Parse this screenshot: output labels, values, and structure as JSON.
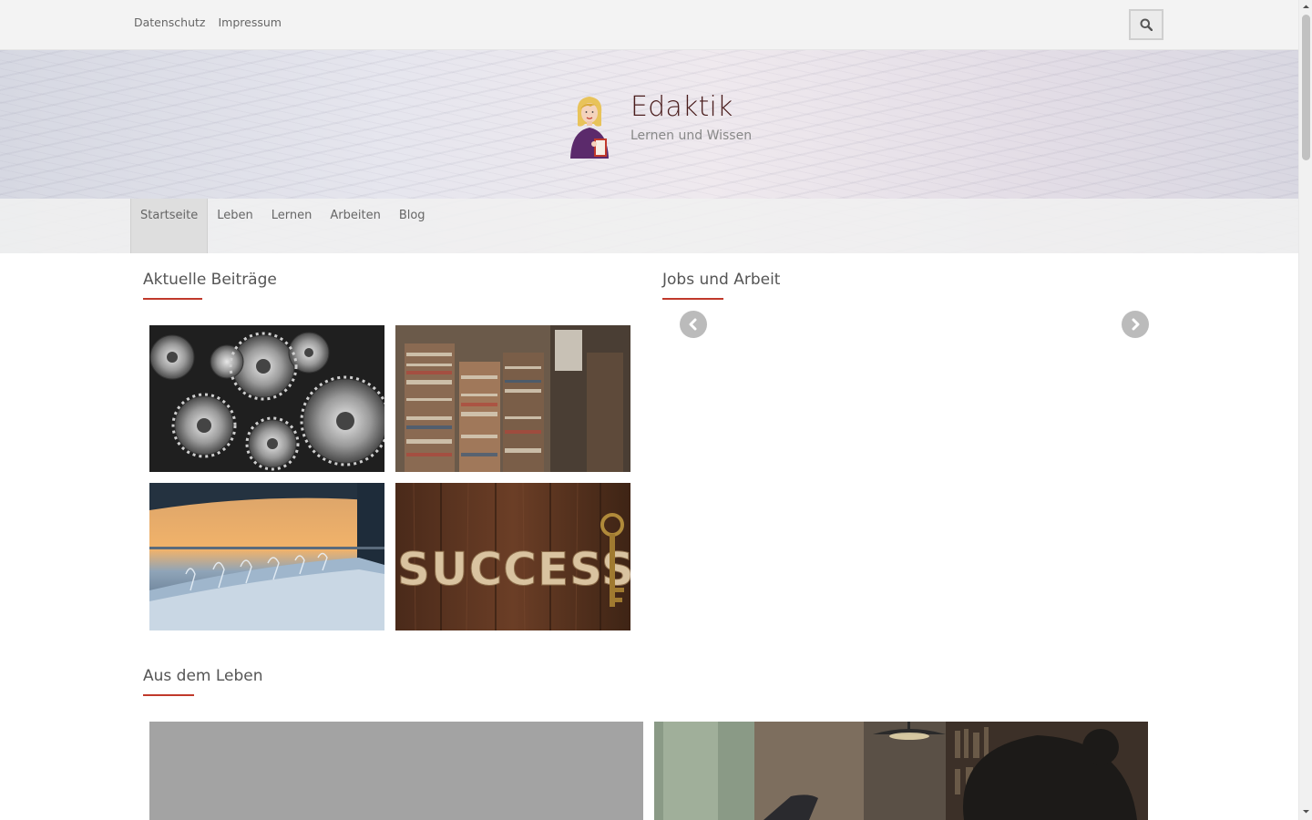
{
  "topbar": {
    "links": [
      {
        "label": "Datenschutz"
      },
      {
        "label": "Impressum"
      }
    ],
    "search_icon": "search-icon"
  },
  "header": {
    "site_title": "Edaktik",
    "tagline": "Lernen und Wissen",
    "logo_icon": "avatar-icon"
  },
  "nav": {
    "items": [
      {
        "label": "Startseite",
        "active": true
      },
      {
        "label": "Leben",
        "active": false
      },
      {
        "label": "Lernen",
        "active": false
      },
      {
        "label": "Arbeiten",
        "active": false
      },
      {
        "label": "Blog",
        "active": false
      }
    ]
  },
  "sections": {
    "recent_posts": {
      "title": "Aktuelle Beiträge"
    },
    "jobs": {
      "title": "Jobs und Arbeit",
      "prev_icon": "chevron-left-icon",
      "next_icon": "chevron-right-icon"
    },
    "life": {
      "title": "Aus dem Leben"
    }
  },
  "tiles": {
    "success_text": "SUCCESS"
  },
  "colors": {
    "accent": "#c0392b",
    "title": "#4a1d1d",
    "topbar_bg": "#f3f3f3"
  }
}
